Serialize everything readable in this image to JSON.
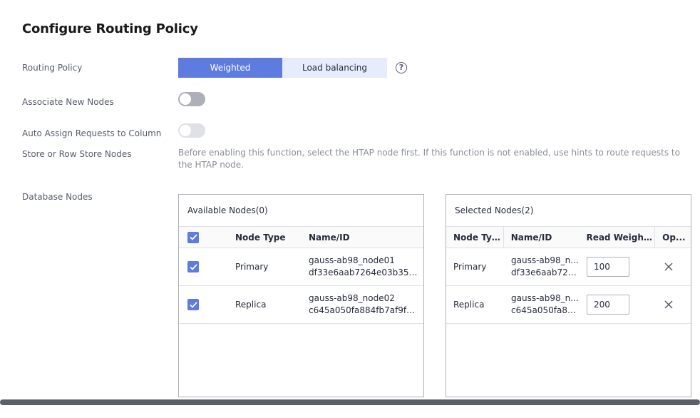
{
  "page": {
    "title": "Configure Routing Policy"
  },
  "routing_policy": {
    "label": "Routing Policy",
    "options": [
      "Weighted",
      "Load balancing"
    ],
    "selected": "Weighted"
  },
  "associate_new_nodes": {
    "label": "Associate New Nodes",
    "enabled": false
  },
  "auto_assign": {
    "label_line1": "Auto Assign Requests to Column",
    "label_line2": "Store or Row Store Nodes",
    "enabled": false,
    "hint": "Before enabling this function, select the HTAP node first. If this function is not enabled, use hints to route requests to the HTAP node."
  },
  "database_nodes": {
    "label": "Database Nodes",
    "available": {
      "title": "Available Nodes(0)",
      "columns": [
        "Node Type",
        "Name/ID"
      ],
      "rows": [
        {
          "checked": true,
          "type": "Primary",
          "name": "gauss-ab98_node01",
          "id": "df33e6aab7264e03b3591..."
        },
        {
          "checked": true,
          "type": "Replica",
          "name": "gauss-ab98_node02",
          "id": "c645a050fa884fb7af9f5de..."
        }
      ]
    },
    "selected": {
      "title": "Selected Nodes(2)",
      "columns": [
        "Node Type",
        "Name/ID",
        "Read Weight...",
        "Op..."
      ],
      "rows": [
        {
          "type": "Primary",
          "name": "gauss-ab98_n...",
          "id": "df33e6aab726...",
          "weight": "100"
        },
        {
          "type": "Replica",
          "name": "gauss-ab98_n...",
          "id": "c645a050fa88...",
          "weight": "200"
        }
      ]
    }
  },
  "colors": {
    "accent": "#5e7ce0",
    "accent_light": "#e6ecfb",
    "toggle_off": "#adb0b8",
    "border": "#dfe1e6"
  }
}
